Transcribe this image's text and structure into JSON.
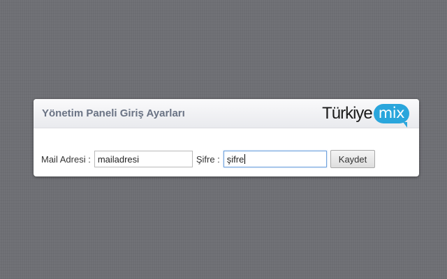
{
  "panel": {
    "title": "Yönetim Paneli Giriş Ayarları",
    "logo": {
      "text_main": "Türkiye",
      "text_bubble": "mix",
      "bubble_color": "#2aa6dc"
    }
  },
  "form": {
    "mail_label": "Mail Adresi :",
    "mail_value": "mailadresi",
    "password_label": "Şifre :",
    "password_value": "şifre",
    "save_label": "Kaydet"
  },
  "colors": {
    "background": "#6e6f74",
    "title": "#6a7384",
    "focus_border": "#6fa2dd"
  }
}
